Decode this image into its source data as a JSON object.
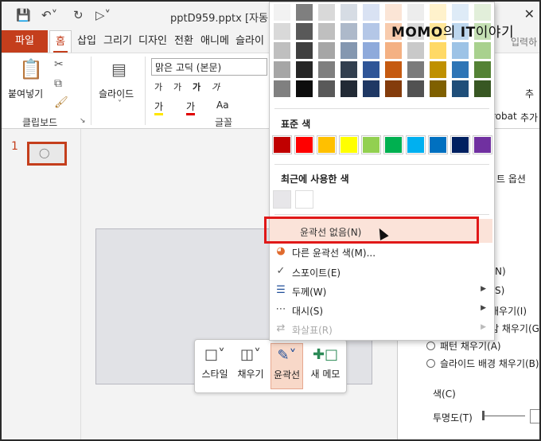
{
  "titlebar": {
    "document_title": "pptD959.pptx [자동 저",
    "badge_bold_1": "MOMO",
    "badge_regular_1": "의 ",
    "badge_bold_2": "IT",
    "badge_regular_2": "이야기",
    "search_hint": "입력하",
    "close_glyph": "✕"
  },
  "tabs": [
    "파일",
    "홈",
    "삽입",
    "그리기",
    "디자인",
    "전환",
    "애니메",
    "슬라이"
  ],
  "ribbon": {
    "paste_label": "붙여넣기",
    "clipboard_group": "클립보드",
    "slide_label": "슬라이드",
    "font_name": "맑은 고딕 (본문)",
    "font_group": "글꼴",
    "acrobat_fragment": "robat",
    "right_fragment_1": "추",
    "right_fragment_2": "추가"
  },
  "thumbnails": {
    "slide_number": "1"
  },
  "dropdown": {
    "theme_colors": [
      [
        "#f2f2f2",
        "#7f7f7f",
        "#d9d9d9",
        "#d6dce4",
        "#d9e2f3",
        "#fbe5d6",
        "#ededed",
        "#fff2cc",
        "#deebf7",
        "#e2efda"
      ],
      [
        "#d9d9d9",
        "#595959",
        "#bfbfbf",
        "#adb9ca",
        "#b4c7e7",
        "#f8cbad",
        "#dbdbdb",
        "#ffe699",
        "#bdd7ee",
        "#c5e0b4"
      ],
      [
        "#bfbfbf",
        "#3f3f3f",
        "#a6a6a6",
        "#8497b0",
        "#8eaadb",
        "#f4b183",
        "#c9c9c9",
        "#ffd966",
        "#9dc3e6",
        "#a9d18e"
      ],
      [
        "#a6a6a6",
        "#262626",
        "#7f7f7f",
        "#323f4f",
        "#2f5597",
        "#c55a11",
        "#7b7b7b",
        "#bf9000",
        "#2e75b6",
        "#548235"
      ],
      [
        "#808080",
        "#0d0d0d",
        "#595959",
        "#222a35",
        "#1f3864",
        "#843c0c",
        "#525252",
        "#7f6000",
        "#1f4e79",
        "#385723"
      ]
    ],
    "standard_title": "표준 색",
    "standard_colors": [
      "#c00000",
      "#ff0000",
      "#ffc000",
      "#ffff00",
      "#92d050",
      "#00b050",
      "#00b0f0",
      "#0070c0",
      "#002060",
      "#7030a0"
    ],
    "recent_title": "최근에 사용한 색",
    "recent_colors": [
      "#e7e6e9",
      "#ffffff"
    ],
    "no_outline": "윤곽선 없음(N)",
    "other_colors": "다른 윤곽선 색(M)...",
    "eyedropper": "스포이트(E)",
    "weight": "두께(W)",
    "dashes": "대시(S)",
    "arrows": "화살표(R)"
  },
  "rightpane": {
    "text_options_fragment": "트 옵션",
    "opt1_fragment": "N)",
    "opt2_fragment": "S)",
    "opt3_fragment": "채우기(I)",
    "opt4_fragment": "감 채우기(G)",
    "pattern_fill": "패턴 채우기(A)",
    "slide_bg_fill": "슬라이드 배경 채우기(B)",
    "color_label": "색(C)",
    "transparency_label": "투명도(T)"
  },
  "minitoolbar": {
    "style": "스타일",
    "fill": "채우기",
    "outline": "윤곽선",
    "new_comment": "새 메모"
  }
}
